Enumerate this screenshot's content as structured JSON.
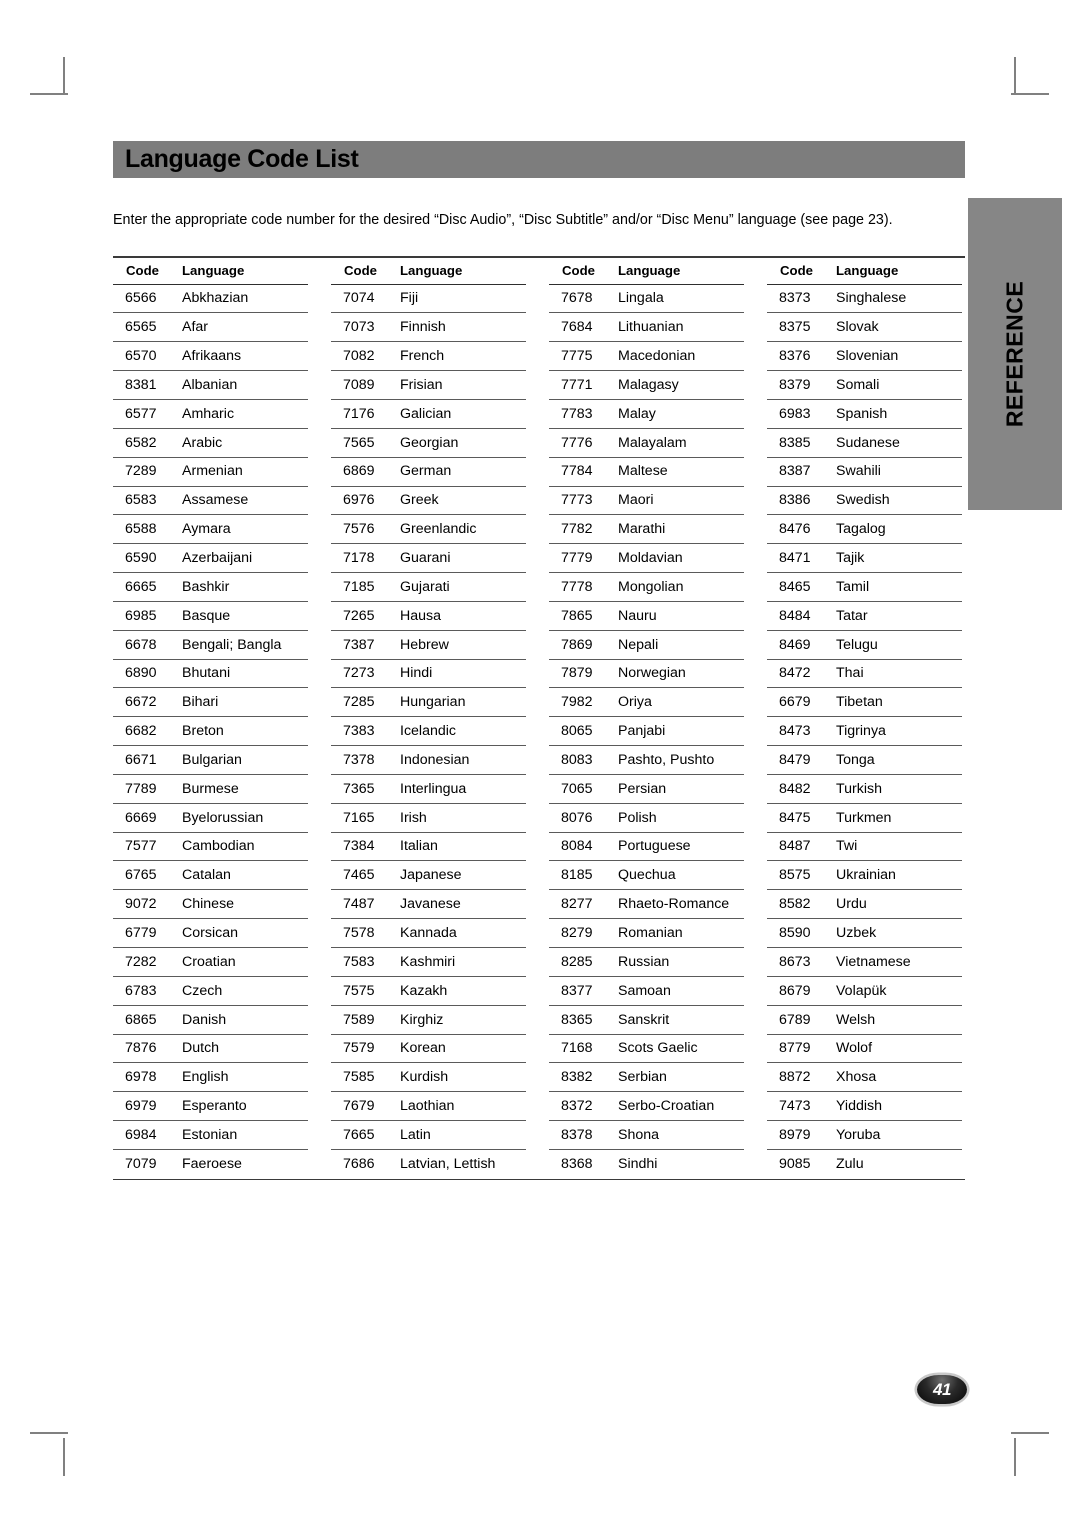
{
  "document": {
    "title": "Language Code List",
    "intro": "Enter the appropriate code number for the desired “Disc Audio”, “Disc Subtitle” and/or “Disc Menu” language (see page 23).",
    "side_tab_label": "REFERENCE",
    "page_number": "41"
  },
  "colors": {
    "title_bar_bg": "#7d7d7d",
    "side_tab_bg": "#868686",
    "rule": "#5a5a5a",
    "text": "#000000",
    "badge_text": "#ffffff"
  },
  "table": {
    "headers": {
      "code": "Code",
      "language": "Language"
    },
    "columns": [
      {
        "rows": [
          {
            "code": "6566",
            "language": "Abkhazian"
          },
          {
            "code": "6565",
            "language": "Afar"
          },
          {
            "code": "6570",
            "language": "Afrikaans"
          },
          {
            "code": "8381",
            "language": "Albanian"
          },
          {
            "code": "6577",
            "language": "Amharic"
          },
          {
            "code": "6582",
            "language": "Arabic"
          },
          {
            "code": "7289",
            "language": "Armenian"
          },
          {
            "code": "6583",
            "language": "Assamese"
          },
          {
            "code": "6588",
            "language": "Aymara"
          },
          {
            "code": "6590",
            "language": "Azerbaijani"
          },
          {
            "code": "6665",
            "language": "Bashkir"
          },
          {
            "code": "6985",
            "language": "Basque"
          },
          {
            "code": "6678",
            "language": "Bengali; Bangla"
          },
          {
            "code": "6890",
            "language": "Bhutani"
          },
          {
            "code": "6672",
            "language": "Bihari"
          },
          {
            "code": "6682",
            "language": "Breton"
          },
          {
            "code": "6671",
            "language": "Bulgarian"
          },
          {
            "code": "7789",
            "language": "Burmese"
          },
          {
            "code": "6669",
            "language": "Byelorussian"
          },
          {
            "code": "7577",
            "language": "Cambodian"
          },
          {
            "code": "6765",
            "language": "Catalan"
          },
          {
            "code": "9072",
            "language": "Chinese"
          },
          {
            "code": "6779",
            "language": "Corsican"
          },
          {
            "code": "7282",
            "language": "Croatian"
          },
          {
            "code": "6783",
            "language": "Czech"
          },
          {
            "code": "6865",
            "language": "Danish"
          },
          {
            "code": "7876",
            "language": "Dutch"
          },
          {
            "code": "6978",
            "language": "English"
          },
          {
            "code": "6979",
            "language": "Esperanto"
          },
          {
            "code": "6984",
            "language": "Estonian"
          },
          {
            "code": "7079",
            "language": "Faeroese"
          }
        ]
      },
      {
        "rows": [
          {
            "code": "7074",
            "language": "Fiji"
          },
          {
            "code": "7073",
            "language": "Finnish"
          },
          {
            "code": "7082",
            "language": "French"
          },
          {
            "code": "7089",
            "language": "Frisian"
          },
          {
            "code": "7176",
            "language": "Galician"
          },
          {
            "code": "7565",
            "language": "Georgian"
          },
          {
            "code": "6869",
            "language": "German"
          },
          {
            "code": "6976",
            "language": "Greek"
          },
          {
            "code": "7576",
            "language": "Greenlandic"
          },
          {
            "code": "7178",
            "language": "Guarani"
          },
          {
            "code": "7185",
            "language": "Gujarati"
          },
          {
            "code": "7265",
            "language": "Hausa"
          },
          {
            "code": "7387",
            "language": "Hebrew"
          },
          {
            "code": "7273",
            "language": "Hindi"
          },
          {
            "code": "7285",
            "language": "Hungarian"
          },
          {
            "code": "7383",
            "language": "Icelandic"
          },
          {
            "code": "7378",
            "language": "Indonesian"
          },
          {
            "code": "7365",
            "language": "Interlingua"
          },
          {
            "code": "7165",
            "language": "Irish"
          },
          {
            "code": "7384",
            "language": "Italian"
          },
          {
            "code": "7465",
            "language": "Japanese"
          },
          {
            "code": "7487",
            "language": "Javanese"
          },
          {
            "code": "7578",
            "language": "Kannada"
          },
          {
            "code": "7583",
            "language": "Kashmiri"
          },
          {
            "code": "7575",
            "language": "Kazakh"
          },
          {
            "code": "7589",
            "language": "Kirghiz"
          },
          {
            "code": "7579",
            "language": "Korean"
          },
          {
            "code": "7585",
            "language": "Kurdish"
          },
          {
            "code": "7679",
            "language": "Laothian"
          },
          {
            "code": "7665",
            "language": "Latin"
          },
          {
            "code": "7686",
            "language": "Latvian, Lettish"
          }
        ]
      },
      {
        "rows": [
          {
            "code": "7678",
            "language": "Lingala"
          },
          {
            "code": "7684",
            "language": "Lithuanian"
          },
          {
            "code": "7775",
            "language": "Macedonian"
          },
          {
            "code": "7771",
            "language": "Malagasy"
          },
          {
            "code": "7783",
            "language": "Malay"
          },
          {
            "code": "7776",
            "language": "Malayalam"
          },
          {
            "code": "7784",
            "language": "Maltese"
          },
          {
            "code": "7773",
            "language": "Maori"
          },
          {
            "code": "7782",
            "language": "Marathi"
          },
          {
            "code": "7779",
            "language": "Moldavian"
          },
          {
            "code": "7778",
            "language": "Mongolian"
          },
          {
            "code": "7865",
            "language": "Nauru"
          },
          {
            "code": "7869",
            "language": "Nepali"
          },
          {
            "code": "7879",
            "language": "Norwegian"
          },
          {
            "code": "7982",
            "language": "Oriya"
          },
          {
            "code": "8065",
            "language": "Panjabi"
          },
          {
            "code": "8083",
            "language": "Pashto, Pushto"
          },
          {
            "code": "7065",
            "language": "Persian"
          },
          {
            "code": "8076",
            "language": "Polish"
          },
          {
            "code": "8084",
            "language": "Portuguese"
          },
          {
            "code": "8185",
            "language": "Quechua"
          },
          {
            "code": "8277",
            "language": "Rhaeto-Romance"
          },
          {
            "code": "8279",
            "language": "Romanian"
          },
          {
            "code": "8285",
            "language": "Russian"
          },
          {
            "code": "8377",
            "language": "Samoan"
          },
          {
            "code": "8365",
            "language": "Sanskrit"
          },
          {
            "code": "7168",
            "language": "Scots Gaelic"
          },
          {
            "code": "8382",
            "language": "Serbian"
          },
          {
            "code": "8372",
            "language": "Serbo-Croatian"
          },
          {
            "code": "8378",
            "language": "Shona"
          },
          {
            "code": "8368",
            "language": "Sindhi"
          }
        ]
      },
      {
        "rows": [
          {
            "code": "8373",
            "language": "Singhalese"
          },
          {
            "code": "8375",
            "language": "Slovak"
          },
          {
            "code": "8376",
            "language": "Slovenian"
          },
          {
            "code": "8379",
            "language": "Somali"
          },
          {
            "code": "6983",
            "language": "Spanish"
          },
          {
            "code": "8385",
            "language": "Sudanese"
          },
          {
            "code": "8387",
            "language": "Swahili"
          },
          {
            "code": "8386",
            "language": "Swedish"
          },
          {
            "code": "8476",
            "language": "Tagalog"
          },
          {
            "code": "8471",
            "language": "Tajik"
          },
          {
            "code": "8465",
            "language": "Tamil"
          },
          {
            "code": "8484",
            "language": "Tatar"
          },
          {
            "code": "8469",
            "language": "Telugu"
          },
          {
            "code": "8472",
            "language": "Thai"
          },
          {
            "code": "6679",
            "language": "Tibetan"
          },
          {
            "code": "8473",
            "language": "Tigrinya"
          },
          {
            "code": "8479",
            "language": "Tonga"
          },
          {
            "code": "8482",
            "language": "Turkish"
          },
          {
            "code": "8475",
            "language": "Turkmen"
          },
          {
            "code": "8487",
            "language": "Twi"
          },
          {
            "code": "8575",
            "language": "Ukrainian"
          },
          {
            "code": "8582",
            "language": "Urdu"
          },
          {
            "code": "8590",
            "language": "Uzbek"
          },
          {
            "code": "8673",
            "language": "Vietnamese"
          },
          {
            "code": "8679",
            "language": "Volapük"
          },
          {
            "code": "6789",
            "language": "Welsh"
          },
          {
            "code": "8779",
            "language": "Wolof"
          },
          {
            "code": "8872",
            "language": "Xhosa"
          },
          {
            "code": "7473",
            "language": "Yiddish"
          },
          {
            "code": "8979",
            "language": "Yoruba"
          },
          {
            "code": "9085",
            "language": "Zulu"
          }
        ]
      }
    ]
  }
}
